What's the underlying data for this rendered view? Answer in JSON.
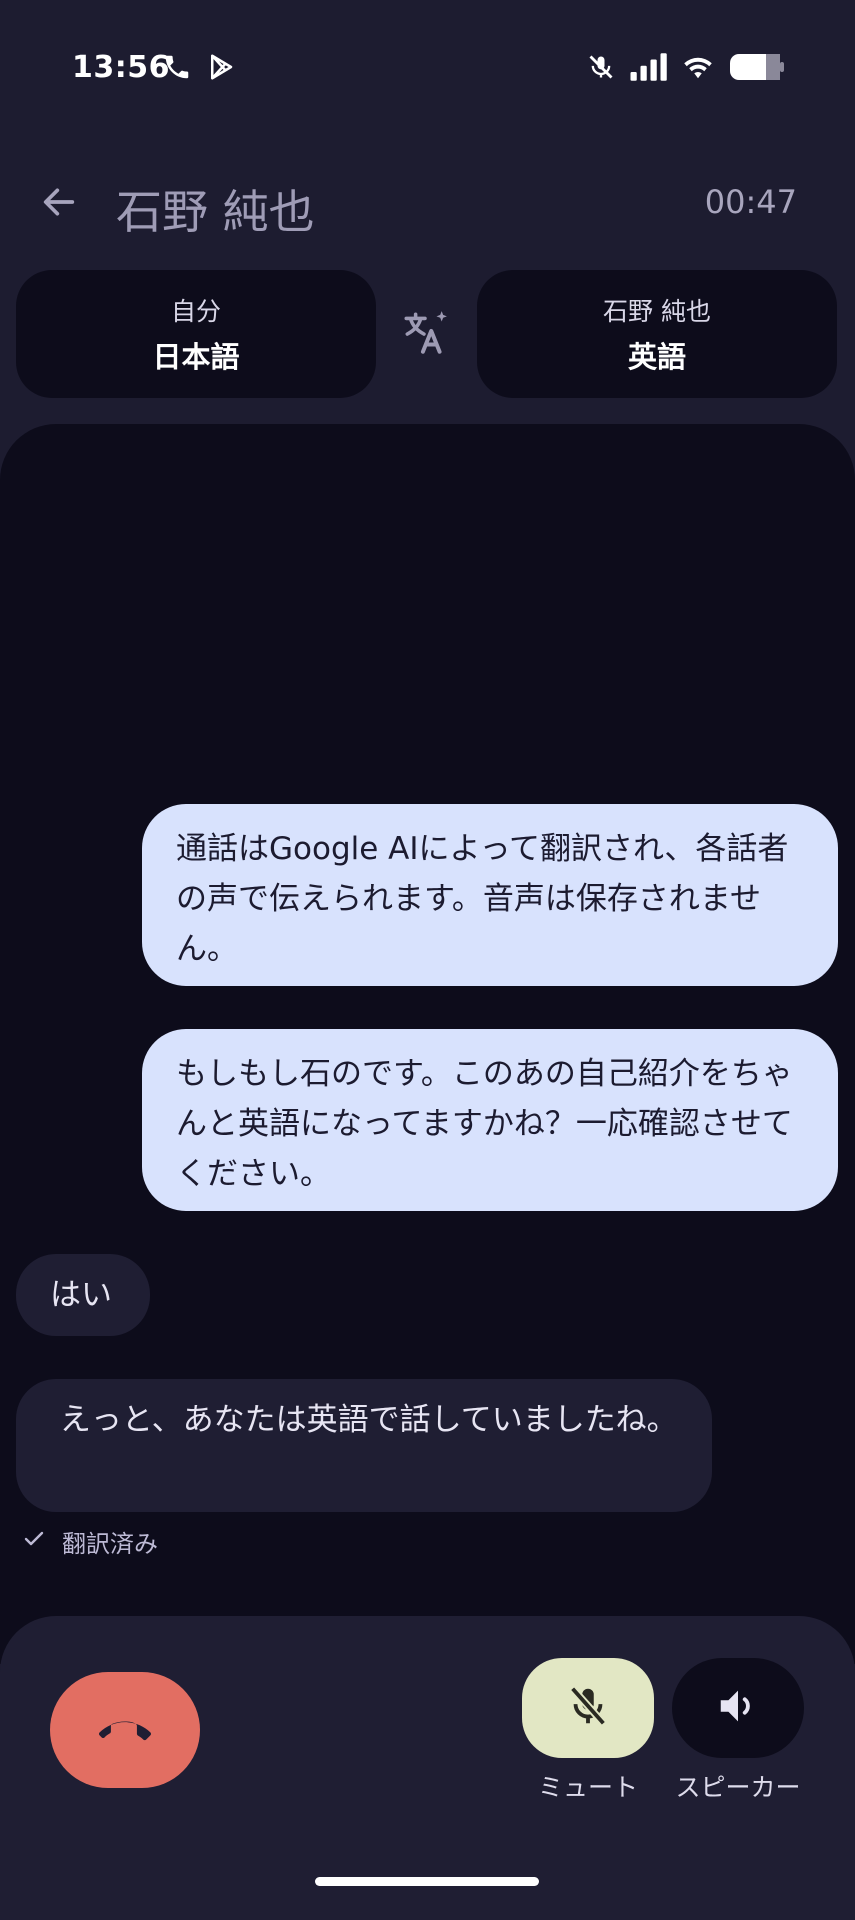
{
  "status_bar": {
    "time": "13:56",
    "left_icons": [
      "phone-icon",
      "play-store-icon"
    ],
    "right_icons": [
      "mic-muted-icon",
      "signal-icon",
      "wifi-icon",
      "battery-icon"
    ]
  },
  "header": {
    "contact_name": "石野 純也",
    "call_duration": "00:47"
  },
  "languages": {
    "self": {
      "owner": "自分",
      "language": "日本語"
    },
    "other": {
      "owner": "石野 純也",
      "language": "英語"
    }
  },
  "transcript": {
    "messages": [
      {
        "direction": "outgoing",
        "text": "通話はGoogle AIによって翻訳され、各話者の声で伝えられます。音声は保存されません。"
      },
      {
        "direction": "outgoing",
        "text": "もしもし石のです。このあの自己紹介をちゃんと英語になってますかね？一応確認させてください。"
      },
      {
        "direction": "incoming",
        "text": "はい"
      },
      {
        "direction": "incoming",
        "text": " えっと、あなたは英語で話していましたね。"
      }
    ],
    "translated_status": "翻訳済み"
  },
  "controls": {
    "mute_label": "ミュート",
    "speaker_label": "スピーカー"
  },
  "colors": {
    "background": "#1d1c30",
    "panel": "#0d0c1b",
    "outgoing_bubble": "#d8e2fd",
    "end_call": "#e26e62",
    "mute_active": "#e2e7c4"
  }
}
